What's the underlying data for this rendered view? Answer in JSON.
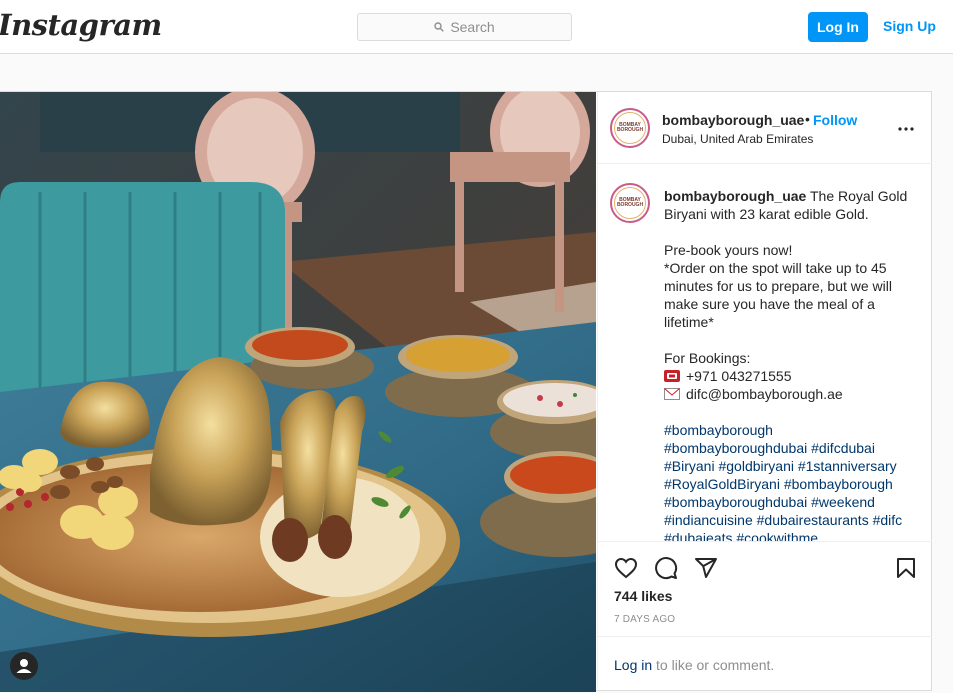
{
  "topbar": {
    "logo": "Instagram",
    "search_placeholder": "Search",
    "login_label": "Log In",
    "signup_label": "Sign Up"
  },
  "post": {
    "username": "bombayborough_uae",
    "follow_label": "Follow",
    "separator": "•",
    "location": "Dubai, United Arab Emirates",
    "avatar_text": "BOMBAY BOROUGH",
    "caption": {
      "username": "bombayborough_uae",
      "line1": "The Royal Gold Biryani with 23 karat edible Gold.",
      "line2": "Pre-book yours now!",
      "line3": "*Order on the spot will take up to 45 minutes for us to prepare, but we will make sure you have the meal of a lifetime*",
      "line4": "For Bookings:",
      "phone": "+971 043271555",
      "email": "difc@bombayborough.ae",
      "hashtags": [
        "#bombayborough",
        "#bombayboroughdubai #difcdubai",
        "#Biryani #goldbiryani #1stanniversary",
        "#RoyalGoldBiryani #bombayborough",
        "#bombayboroughdubai #weekend",
        "#indiancuisine #dubairestaurants #difc",
        "#dubaieats #cookwithme"
      ]
    },
    "likes": "744 likes",
    "time": "7 DAYS AGO",
    "login_link": "Log in",
    "login_suffix": " to like or comment."
  },
  "icons": {
    "like": "heart-icon",
    "comment": "comment-icon",
    "share": "share-icon",
    "save": "bookmark-icon",
    "more": "more-options-icon",
    "phone": "telephone-icon",
    "email": "envelope-icon",
    "search": "search-icon",
    "account": "user-account-icon"
  },
  "colors": {
    "accent": "#0095f6",
    "hashtag": "#00376b",
    "border": "#dbdbdb",
    "muted": "#8e8e8e"
  }
}
